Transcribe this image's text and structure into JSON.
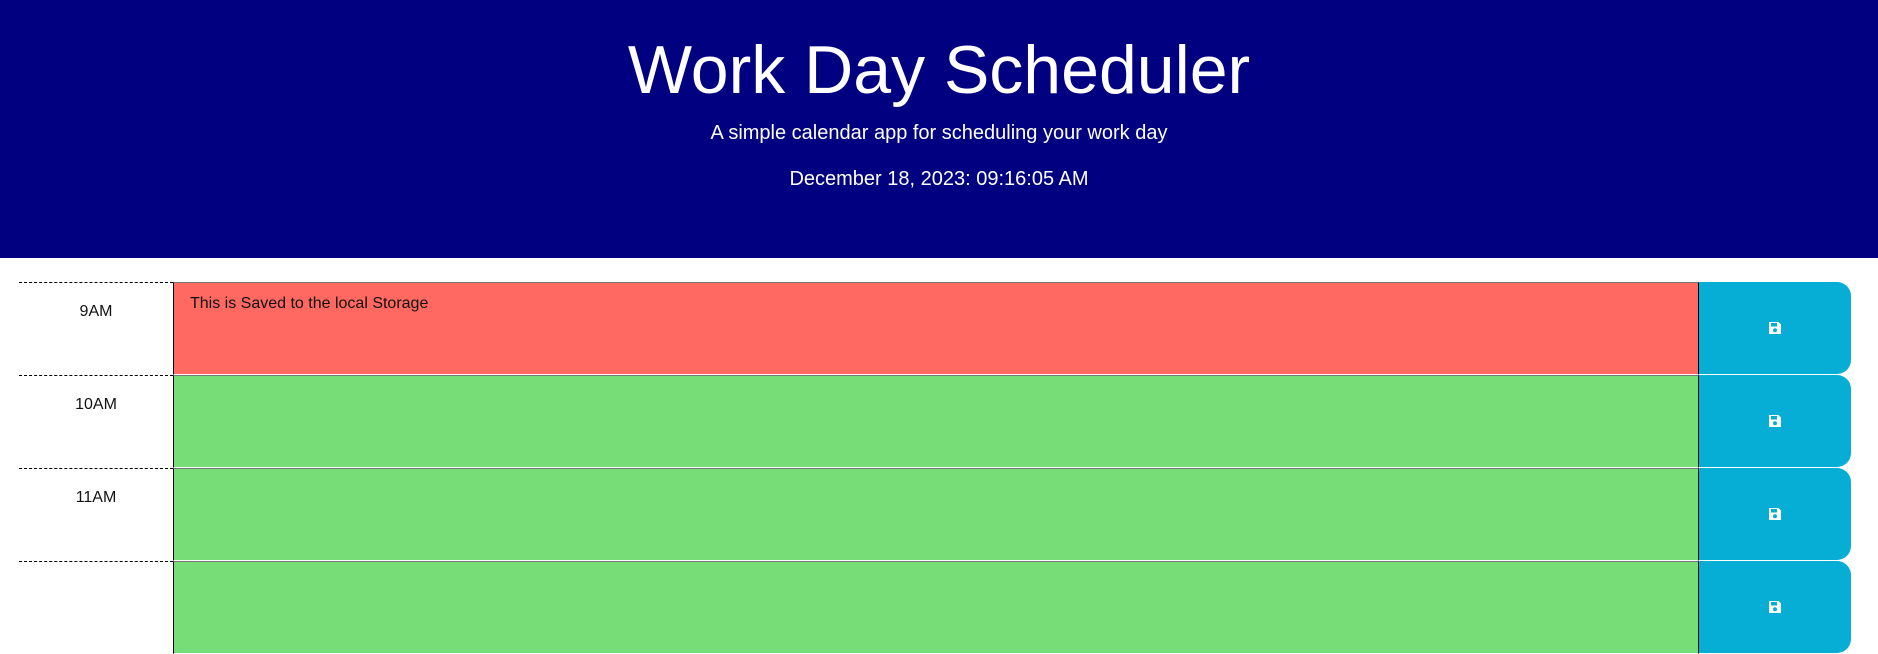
{
  "header": {
    "title": "Work Day Scheduler",
    "lead": "A simple calendar app for scheduling your work day",
    "current_datetime": "December 18, 2023: 09:16:05 AM"
  },
  "colors": {
    "header_bg": "#000080",
    "present": "#ff6961",
    "future": "#77dd77",
    "save_button": "#06aed5"
  },
  "timeblocks": [
    {
      "hour": "9AM",
      "text": "This is Saved to the local Storage",
      "state": "present",
      "save_icon": "save-icon"
    },
    {
      "hour": "10AM",
      "text": "",
      "state": "future",
      "save_icon": "save-icon"
    },
    {
      "hour": "11AM",
      "text": "",
      "state": "future",
      "save_icon": "save-icon"
    },
    {
      "hour": "",
      "text": "",
      "state": "future",
      "save_icon": "save-icon"
    }
  ]
}
